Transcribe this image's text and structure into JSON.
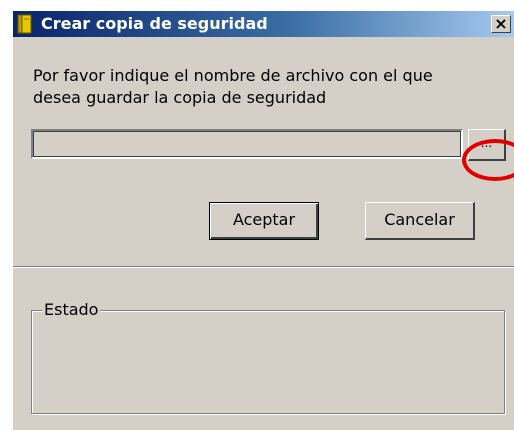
{
  "window": {
    "title": "Crear copia de seguridad",
    "close_label": "×"
  },
  "instructions": "Por favor indique el nombre de archivo con el que\ndesea guardar la copia de seguridad",
  "file_field": {
    "value": "",
    "placeholder": ""
  },
  "browse_button": {
    "label": "..."
  },
  "buttons": {
    "ok_label": "Aceptar",
    "cancel_label": "Cancelar"
  },
  "status_group": {
    "label": "Estado"
  },
  "colors": {
    "annotation_circle": "#e00000",
    "titlebar_start": "#0a246a",
    "titlebar_end": "#a6caf0",
    "face": "#d4d0c8"
  }
}
